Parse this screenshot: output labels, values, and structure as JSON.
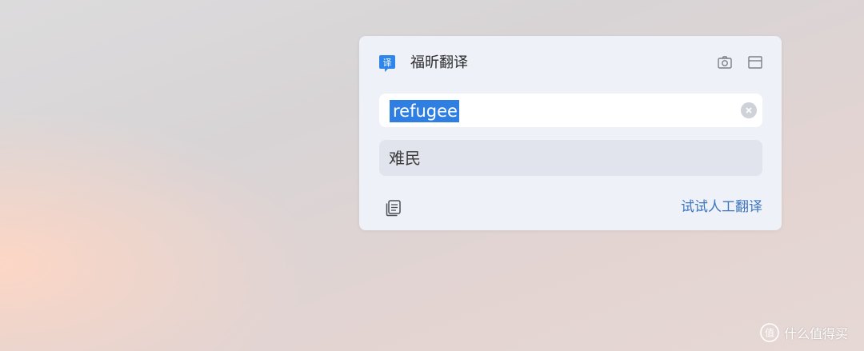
{
  "app": {
    "title": "福昕翻译",
    "logo_glyph": "译",
    "accent_color": "#2f7fe2"
  },
  "header_icons": [
    "camera-icon",
    "window-icon"
  ],
  "input": {
    "value": "refugee",
    "clear_icon": "clear-icon"
  },
  "result": {
    "text": "难民"
  },
  "footer": {
    "copy_icon": "copy-icon",
    "human_translate_label": "试试人工翻译"
  },
  "watermark": {
    "text": "什么值得买",
    "glyph": "值"
  }
}
